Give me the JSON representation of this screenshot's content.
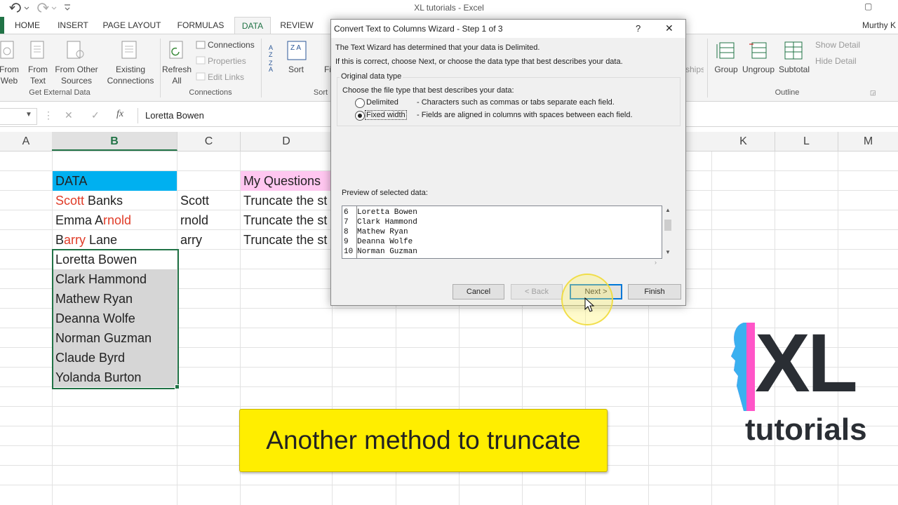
{
  "window": {
    "title": "XL tutorials - Excel",
    "user": "Murthy K"
  },
  "tabs": [
    "HOME",
    "INSERT",
    "PAGE LAYOUT",
    "FORMULAS",
    "DATA",
    "REVIEW"
  ],
  "active_tab": "DATA",
  "ribbon": {
    "from_web": "From\nWeb",
    "from_text": "From\nText",
    "from_other": "From Other\nSources",
    "existing": "Existing\nConnections",
    "get_external": "Get External Data",
    "refresh": "Refresh\nAll",
    "connections": "Connections",
    "properties": "Properties",
    "edit_links": "Edit Links",
    "connections_group": "Connections",
    "sort": "Sort",
    "filter": "Fi",
    "sort_group": "Sort",
    "relationships": "ships",
    "group": "Group",
    "ungroup": "Ungroup",
    "subtotal": "Subtotal",
    "show_detail": "Show Detail",
    "hide_detail": "Hide Detail",
    "outline_group": "Outline"
  },
  "formula": {
    "value": "Loretta Bowen",
    "cancel": "✕",
    "enter": "✓",
    "fx": "fx"
  },
  "columns": [
    "A",
    "B",
    "C",
    "D",
    "K",
    "L",
    "M"
  ],
  "cells": {
    "b_header": "DATA",
    "d_header": "My Questions",
    "b_rows": [
      {
        "pre": "",
        "red": "Scott",
        "post": " Banks"
      },
      {
        "pre": "Emma A",
        "red": "rnold",
        "post": ""
      },
      {
        "pre": "B",
        "red": "arry",
        "post": " Lane"
      }
    ],
    "b_selected": [
      "Loretta Bowen",
      "Clark Hammond",
      "Mathew Ryan",
      "Deanna Wolfe",
      "Norman Guzman",
      "Claude Byrd",
      "Yolanda Burton"
    ],
    "c_values": [
      "Scott",
      "rnold",
      "arry"
    ],
    "d_values": [
      "Truncate the st",
      "Truncate the st",
      "Truncate the st"
    ]
  },
  "dialog": {
    "title": "Convert Text to Columns Wizard - Step 1 of 3",
    "help": "?",
    "close": "✕",
    "line1": "The Text Wizard has determined that your data is Delimited.",
    "line2": "If this is correct, choose Next, or choose the data type that best describes your data.",
    "group_label": "Original data type",
    "choose_label": "Choose the file type that best describes your data:",
    "opt_delimited": "Delimited",
    "opt_delimited_desc": "- Characters such as commas or tabs separate each field.",
    "opt_fixed": "Fixed width",
    "opt_fixed_desc": "- Fields are aligned in columns with spaces between each field.",
    "selected_option": "Fixed width",
    "preview_label": "Preview of selected data:",
    "preview_rows": [
      {
        "num": "6",
        "text": "Loretta Bowen"
      },
      {
        "num": "7",
        "text": "Clark Hammond"
      },
      {
        "num": "8",
        "text": "Mathew Ryan"
      },
      {
        "num": "9",
        "text": "Deanna Wolfe"
      },
      {
        "num": "10",
        "text": "Norman Guzman"
      }
    ],
    "btn_cancel": "Cancel",
    "btn_back": "< Back",
    "btn_next": "Next >",
    "btn_finish": "Finish"
  },
  "caption": "Another method to truncate",
  "logo": {
    "mark": "XL",
    "word": "tutorials"
  },
  "colors": {
    "excel_green": "#217346",
    "data_header": "#00b0f0",
    "question_header": "#ffc7f0",
    "caption_bg": "#ffee00",
    "red_text": "#e03c28",
    "highlight": "#fff36b"
  }
}
